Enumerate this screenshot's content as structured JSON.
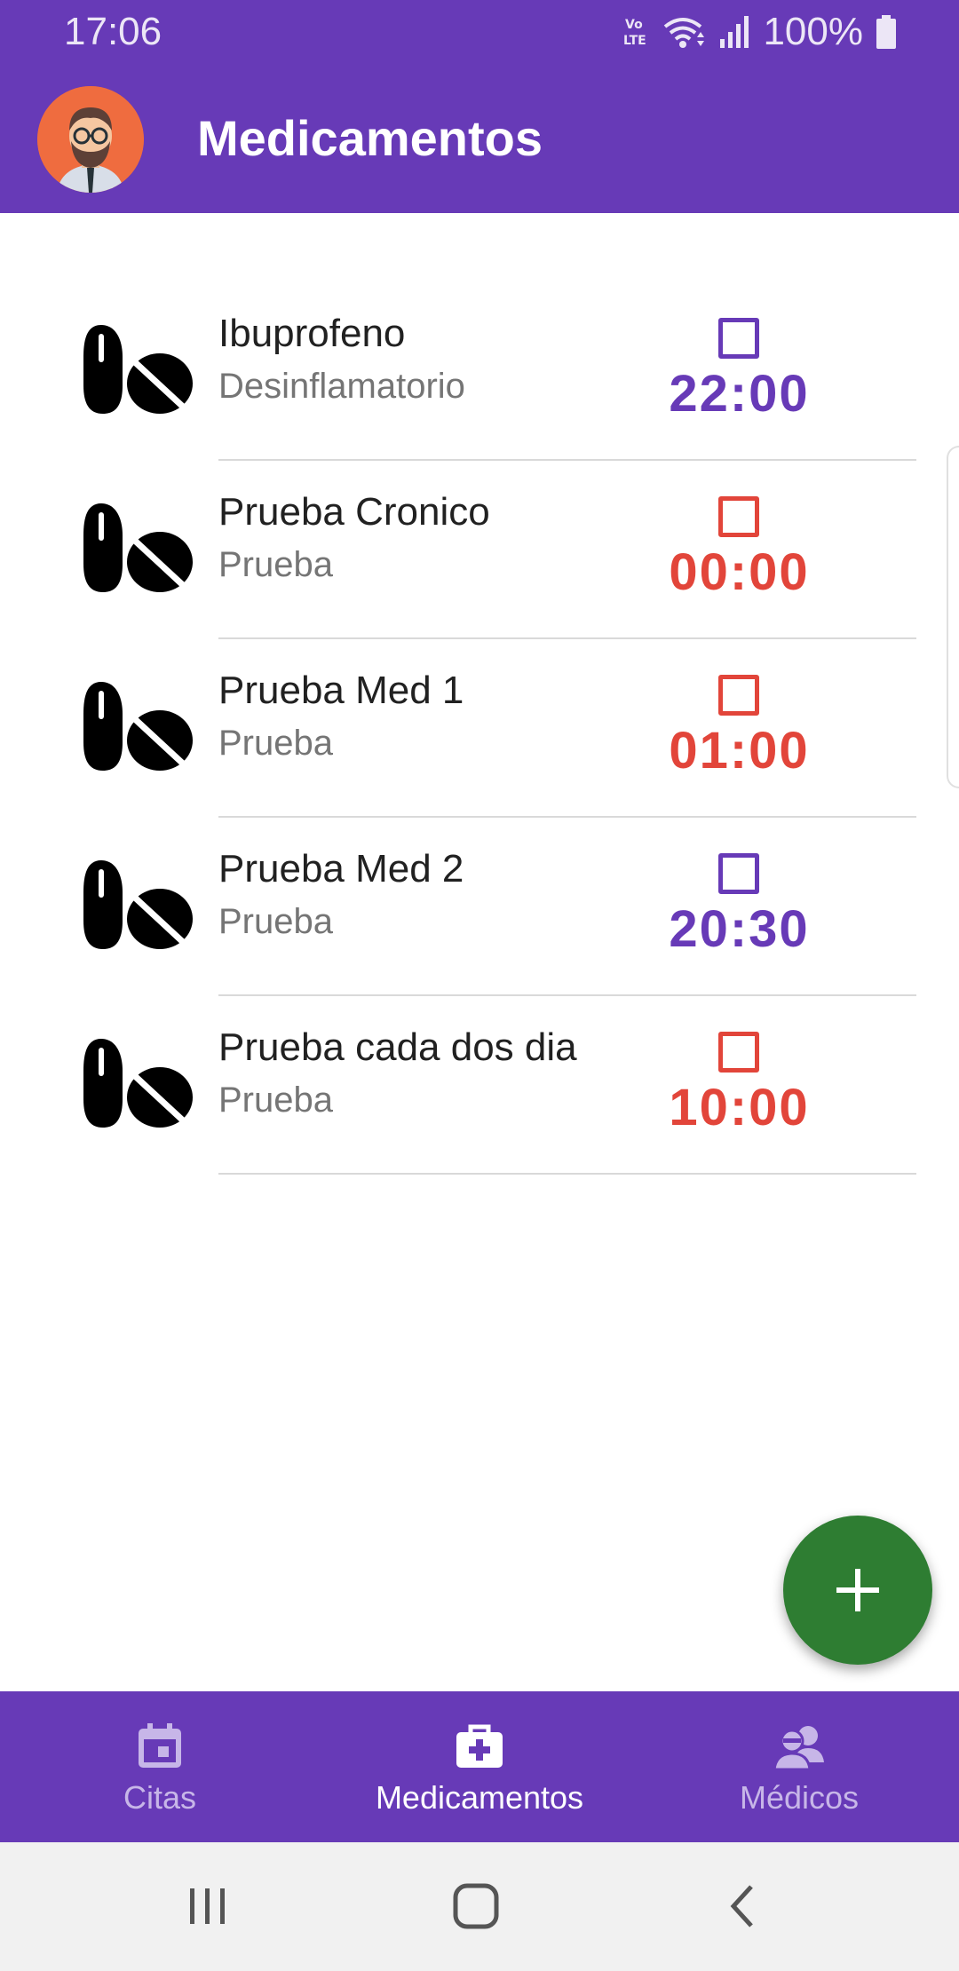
{
  "status_bar": {
    "time": "17:06",
    "battery": "100%",
    "network_label": "Vo LTE"
  },
  "app_bar": {
    "title": "Medicamentos",
    "avatar_icon": "bearded-man-avatar-icon"
  },
  "colors": {
    "primary": "#673ab7",
    "purple_time": "#673ab7",
    "red_time": "#e2453a",
    "fab": "#2e7d32"
  },
  "medications": [
    {
      "name": "Ibuprofeno",
      "description": "Desinflamatorio",
      "time": "22:00",
      "status": "pending",
      "checked": false
    },
    {
      "name": "Prueba Cronico",
      "description": "Prueba",
      "time": "00:00",
      "status": "overdue",
      "checked": false
    },
    {
      "name": "Prueba Med 1",
      "description": "Prueba",
      "time": "01:00",
      "status": "overdue",
      "checked": false
    },
    {
      "name": "Prueba Med 2",
      "description": "Prueba",
      "time": "20:30",
      "status": "pending",
      "checked": false
    },
    {
      "name": "Prueba cada dos dia",
      "description": "Prueba",
      "time": "10:00",
      "status": "overdue",
      "checked": false
    }
  ],
  "fab": {
    "icon": "plus-icon"
  },
  "bottom_nav": {
    "items": [
      {
        "label": "Citas",
        "icon": "calendar-icon",
        "active": false
      },
      {
        "label": "Medicamentos",
        "icon": "medical-kit-icon",
        "active": true
      },
      {
        "label": "Médicos",
        "icon": "doctors-icon",
        "active": false
      }
    ]
  },
  "system_nav": [
    "recents-icon",
    "home-icon",
    "back-icon"
  ]
}
